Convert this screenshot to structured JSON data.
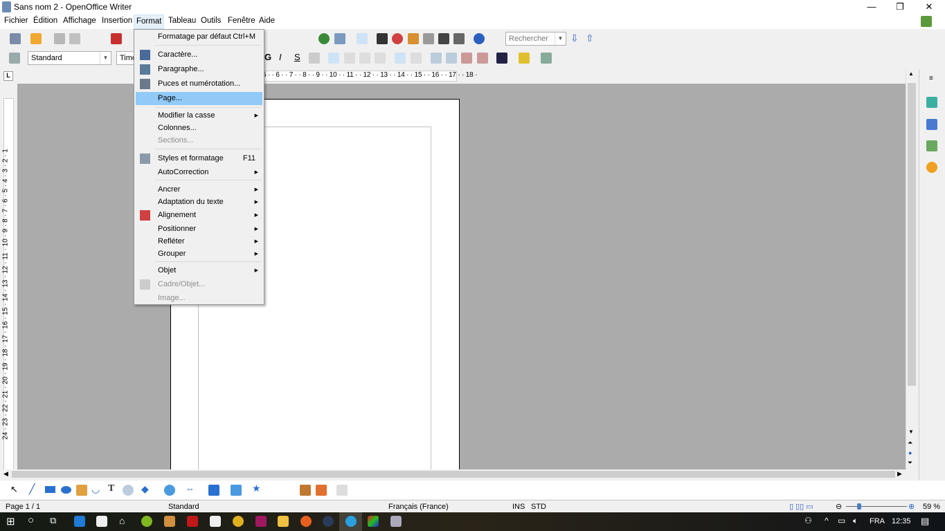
{
  "window": {
    "title": "Sans nom 2 - OpenOffice Writer",
    "controls": [
      "minimize",
      "maximize",
      "close"
    ]
  },
  "menubar": [
    "Fichier",
    "Édition",
    "Affichage",
    "Insertion",
    "Format",
    "Tableau",
    "Outils",
    "Fenêtre",
    "Aide"
  ],
  "toolbar": {
    "style_value": "Standard",
    "font_value": "Time",
    "search_placeholder": "Rechercher"
  },
  "ruler": {
    "marks": "5 · · 6 · · 7 · · 8 · · 9 · · 10 · · 11 · · 12 · · 13 · · 14 · · 15 · · 16 · · 17 · · 18 ·",
    "vmarks": "1 · 2 · 3 · 4 · 5 · 6 · 7 · 8 · 9 · 10 · 11 · 12 · 13 · 14 · 15 · 16 · 17 · 18 · 19 · 20 · 21 · 22 · 23 · 24"
  },
  "format_menu": {
    "items": [
      {
        "label": "Formatage par défaut",
        "shortcut": "Ctrl+M"
      },
      {
        "label": "Caractère..."
      },
      {
        "label": "Paragraphe..."
      },
      {
        "label": "Puces et numérotation..."
      },
      {
        "label": "Page...",
        "highlighted": true
      },
      {
        "label": "Modifier la casse",
        "submenu": true
      },
      {
        "label": "Colonnes..."
      },
      {
        "label": "Sections...",
        "disabled": true
      },
      {
        "label": "Styles et formatage",
        "shortcut": "F11"
      },
      {
        "label": "AutoCorrection",
        "submenu": true
      },
      {
        "label": "Ancrer",
        "submenu": true
      },
      {
        "label": "Adaptation du texte",
        "submenu": true
      },
      {
        "label": "Alignement",
        "submenu": true
      },
      {
        "label": "Positionner",
        "submenu": true
      },
      {
        "label": "Refléter",
        "submenu": true
      },
      {
        "label": "Grouper",
        "submenu": true
      },
      {
        "label": "Objet",
        "submenu": true
      },
      {
        "label": "Cadre/Objet...",
        "disabled": true
      },
      {
        "label": "Image...",
        "disabled": true
      }
    ]
  },
  "status": {
    "page": "Page 1 / 1",
    "style": "Standard",
    "language": "Français (France)",
    "ins": "INS",
    "std": "STD",
    "zoom": "59 %",
    "zoom_level": 59
  },
  "taskbar": {
    "lang": "FRA",
    "time": "12:35"
  },
  "colors": {
    "highlight": "#91c9f7",
    "doc_bg": "#ababab"
  }
}
